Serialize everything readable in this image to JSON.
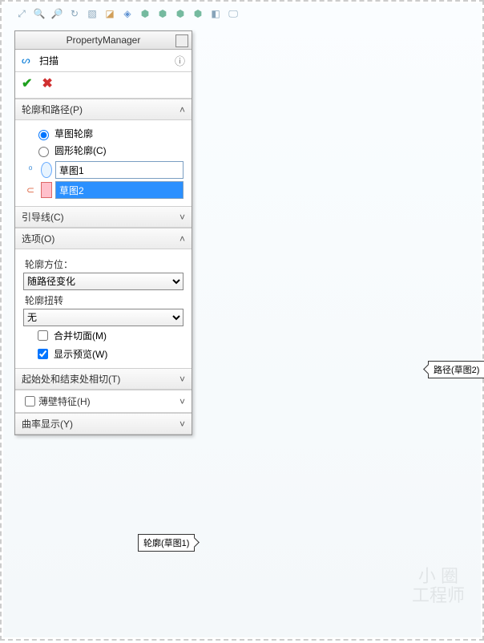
{
  "panel": {
    "title": "PropertyManager",
    "feature_name": "扫描",
    "sections": {
      "profile_path": {
        "title": "轮廓和路径(P)",
        "open": true,
        "radio_sketch": "草图轮廓",
        "radio_circle": "圆形轮廓(C)",
        "profile_field": "草图1",
        "path_field": "草图2"
      },
      "guides": {
        "title": "引导线(C)",
        "open": false
      },
      "options": {
        "title": "选项(O)",
        "open": true,
        "orientation_label": "轮廓方位：",
        "orientation_value": "随路径变化",
        "twist_label": "轮廓扭转",
        "twist_value": "无",
        "merge_tangent": "合并切面(M)",
        "show_preview": "显示预览(W)"
      },
      "start_end": {
        "title": "起始处和结束处相切(T)",
        "open": false
      },
      "thin": {
        "title": "薄壁特征(H)",
        "open": false,
        "checked": false
      },
      "curvature": {
        "title": "曲率显示(Y)",
        "open": false
      }
    }
  },
  "callouts": {
    "path": "路径(草图2)",
    "profile": "轮廓(草图1)"
  },
  "watermark": {
    "l1": "小 圈",
    "l2": "工程师"
  }
}
